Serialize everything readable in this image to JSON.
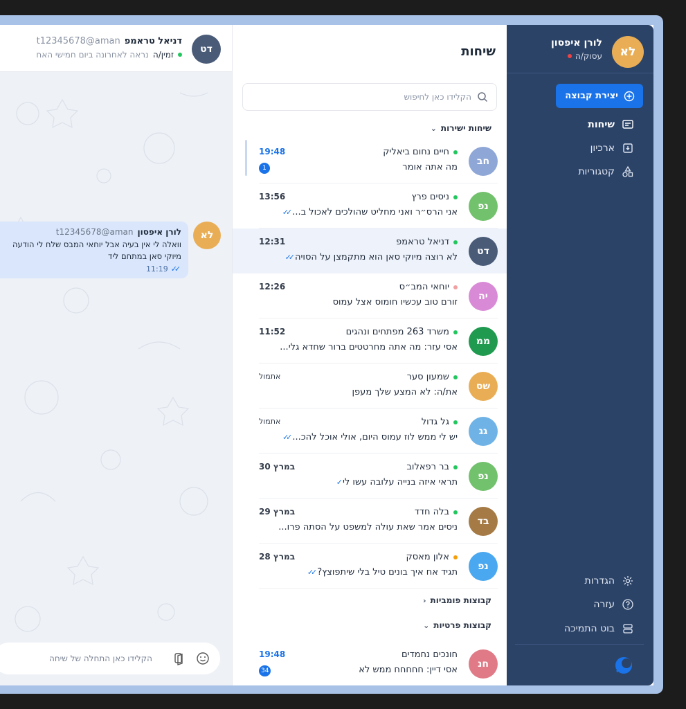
{
  "colors": {
    "sidebar_bg": "#2c4368",
    "accent": "#1a73e8",
    "selected_row": "#eef3fb",
    "bubble": "#d9e6fb",
    "online": "#22c55e",
    "busy": "#ef4444",
    "away": "#f59e0b"
  },
  "profile": {
    "initials": "לא",
    "name": "לורן איפסון",
    "status": "עסוק/ה"
  },
  "sidebar": {
    "create_group": "יצירת קבוצה",
    "nav": [
      {
        "label": "שיחות",
        "icon": "chat-icon"
      },
      {
        "label": "ארכיון",
        "icon": "archive-icon"
      },
      {
        "label": "קטגוריות",
        "icon": "categories-icon"
      }
    ],
    "bottom": [
      {
        "label": "הגדרות",
        "icon": "gear-icon"
      },
      {
        "label": "עזרה",
        "icon": "help-icon"
      },
      {
        "label": "בוט התמיכה",
        "icon": "bot-icon"
      }
    ]
  },
  "chats": {
    "title": "שיחות",
    "search_placeholder": "הקלידו כאן לחיפוש",
    "section_direct": "שיחות ישירות",
    "section_public": "קבוצות פומביות",
    "section_private": "קבוצות פרטיות",
    "direct": [
      {
        "initials": "חב",
        "name": "חיים נחום ביאליק",
        "message": "מה אתה אומר",
        "time": "19:48",
        "badge": "1",
        "status": "online",
        "avatar": "#8fa7d6"
      },
      {
        "initials": "נפ",
        "name": "ניסים פרץ",
        "message": "אני הרס״ר ואני מחליט שהולכים לאכול ב...",
        "time": "13:56",
        "ticks": "double",
        "status": "online",
        "avatar": "#72c16d"
      },
      {
        "initials": "דט",
        "name": "דניאל טראמפ",
        "message": "לא רוצה מיוקי סאן הוא מתקמצן על הסויה",
        "time": "12:31",
        "ticks": "double",
        "status": "online",
        "avatar": "#4a5b78"
      },
      {
        "initials": "יה",
        "name": "יוחאי המב״ס",
        "message": "זורם טוב עכשיו חומוס אצל עמוס",
        "time": "12:26",
        "status": "busy",
        "avatar": "#d98ad6"
      },
      {
        "initials": "ממ",
        "name": "משרד 263 מפתחים ונהגים",
        "message": "אסי עזר: מה אתה מחרטטים ברור שחדא גלי...",
        "time": "11:52",
        "status": "online",
        "avatar": "#1f9a4f"
      },
      {
        "initials": "שס",
        "name": "שמעון סער",
        "message": "את/ה: לא המצע שלך מעפן",
        "time": "אתמול",
        "status": "online",
        "avatar": "#e9ae55"
      },
      {
        "initials": "גג",
        "name": "גל גדול",
        "message": "יש לי ממש לוז עמוס היום, אולי אוכל להכ...",
        "time": "אתמול",
        "ticks": "double",
        "status": "online",
        "avatar": "#6fb3e6"
      },
      {
        "initials": "נפ",
        "name": "בר רפאלוב",
        "message": "תראי איזה בנייה עלובה עשו לי",
        "time": "30 במרץ",
        "ticks": "single",
        "status": "online",
        "avatar": "#72c16d"
      },
      {
        "initials": "בד",
        "name": "בלה חדד",
        "message": "ניסים אמר שאת עולה למשפט על הסתה פרו...",
        "time": "29 במרץ",
        "status": "online",
        "avatar": "#a57a45"
      },
      {
        "initials": "נפ",
        "name": "אלון מאסק",
        "message": "תגיד אח איך בונים טיל בלי שיתפוצץ?",
        "time": "28 במרץ",
        "ticks": "double",
        "status": "away",
        "avatar": "#4aa8f0"
      }
    ],
    "private": [
      {
        "initials": "חנ",
        "name": "חונכים נחמדים",
        "message": "אסי דיין: חחחחח ממש לא",
        "time": "19:48",
        "badge": "34",
        "avatar": "#e07a86"
      }
    ]
  },
  "conversation": {
    "initials": "דט",
    "name": "דניאל טראמפ",
    "handle": "t12345678@aman",
    "status": "זמין/ה",
    "last_seen": "נראה לאחרונה ביום חמישי האח",
    "message": {
      "initials": "לא",
      "sender": "לורן איפסון",
      "handle": "t12345678@aman",
      "line1": "וואלה לי אין בעיה אבל יוחאי המבס שלח לי הודעה",
      "line2": "מיוקי סאן במתחם ליד",
      "time": "11:19"
    },
    "composer_placeholder": "הקלידו כאן התחלה של שיחה"
  }
}
